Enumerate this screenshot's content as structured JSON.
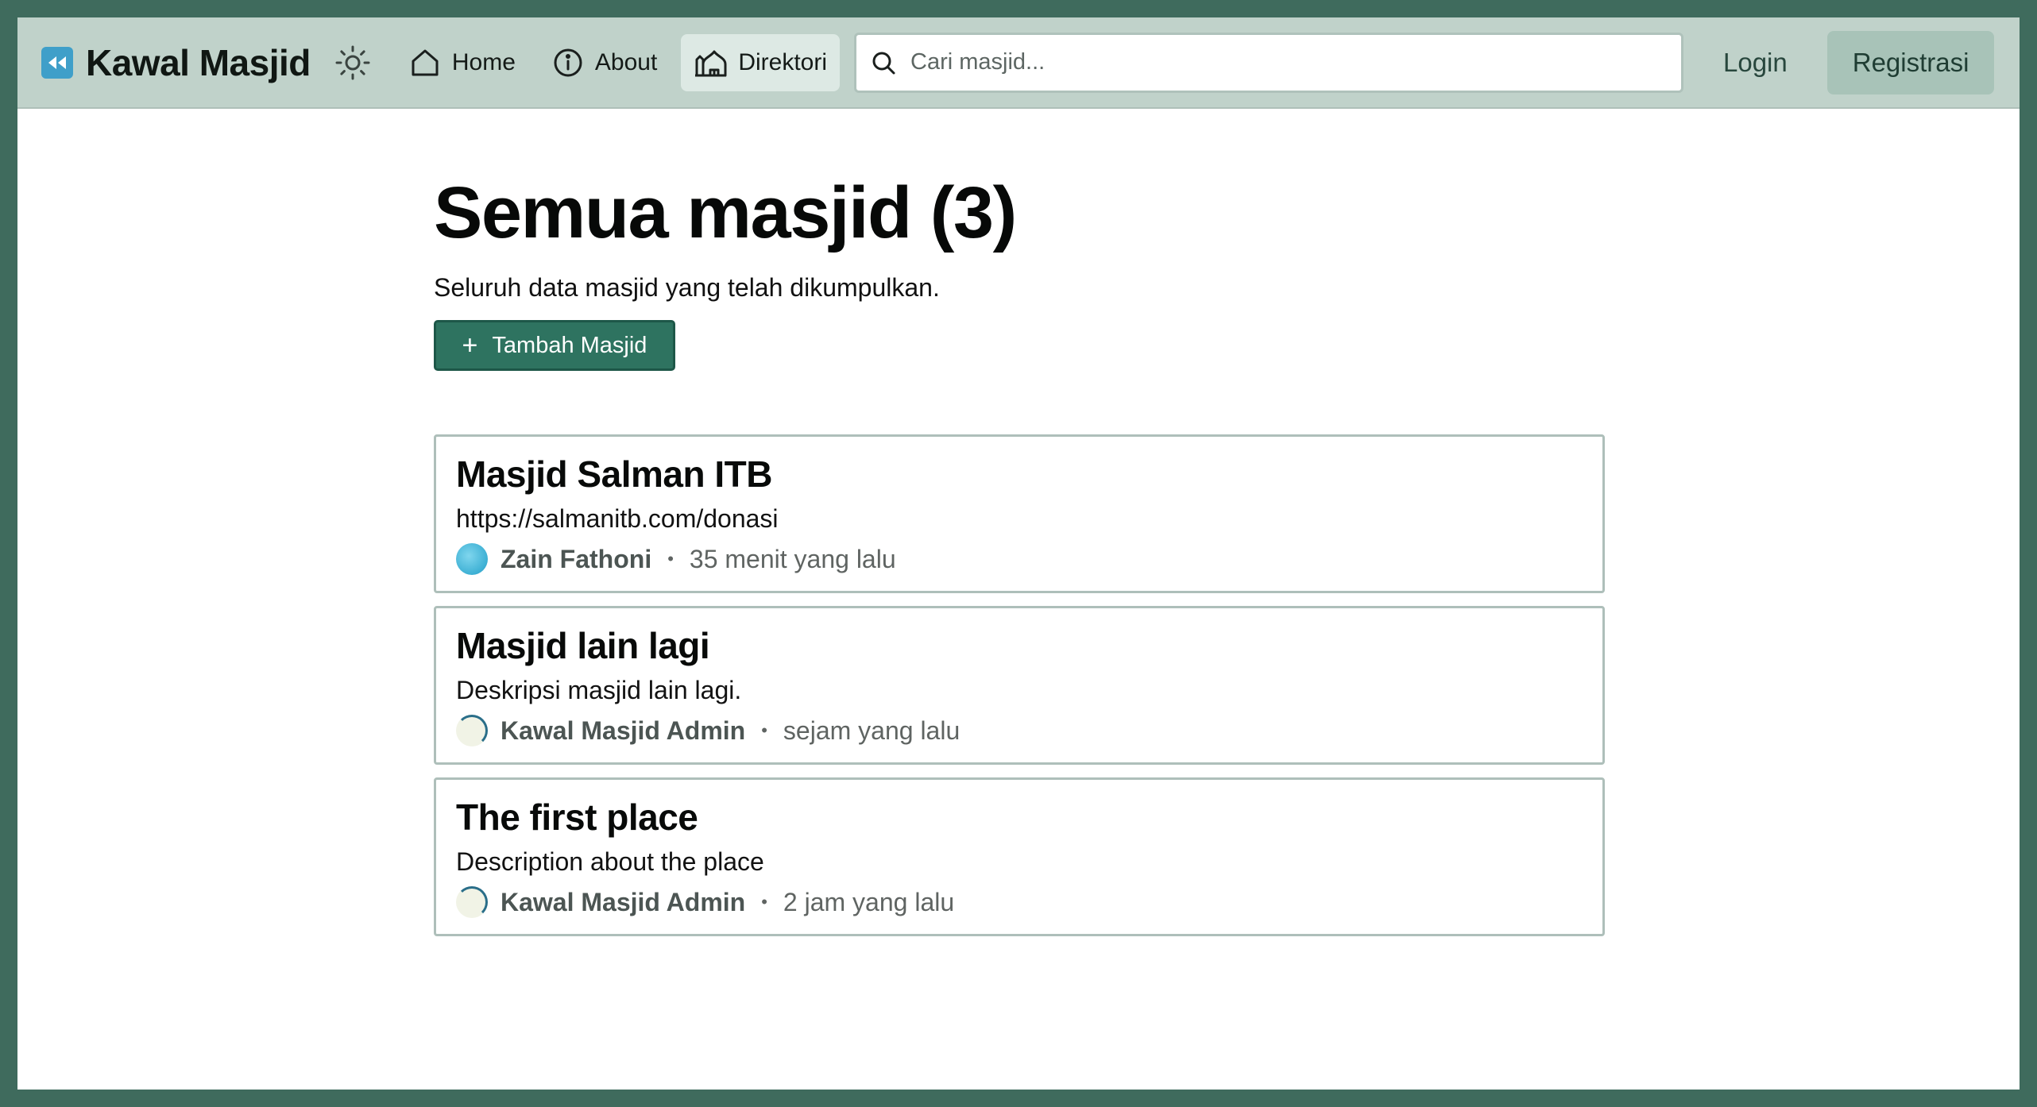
{
  "brand": {
    "name": "Kawal Masjid",
    "logo_icon": "rewind-icon",
    "logo_color": "#3f9fc9"
  },
  "nav": {
    "theme_toggle_icon": "sun-icon",
    "links": [
      {
        "label": "Home",
        "icon": "home-icon"
      },
      {
        "label": "About",
        "icon": "info-icon"
      },
      {
        "label": "Direktori",
        "icon": "mosque-icon",
        "active": true
      }
    ],
    "search": {
      "placeholder": "Cari masjid...",
      "value": ""
    },
    "login_label": "Login",
    "register_label": "Registrasi"
  },
  "main": {
    "title": "Semua masjid (3)",
    "subtitle": "Seluruh data masjid yang telah dikumpulkan.",
    "add_button": {
      "icon": "+",
      "label": "Tambah Masjid"
    },
    "mosques": [
      {
        "title": "Masjid Salman ITB",
        "description": "https://salmanitb.com/donasi",
        "author": "Zain Fathoni",
        "time": "35 menit yang lalu"
      },
      {
        "title": "Masjid lain lagi",
        "description": "Deskripsi masjid lain lagi.",
        "author": "Kawal Masjid Admin",
        "time": "sejam yang lalu"
      },
      {
        "title": "The first place",
        "description": "Description about the place",
        "author": "Kawal Masjid Admin",
        "time": "2 jam yang lalu"
      }
    ],
    "separator": "•"
  },
  "colors": {
    "navbar": "#c0d2ca",
    "primary": "#2e7360",
    "frame": "#3f6b5d"
  }
}
